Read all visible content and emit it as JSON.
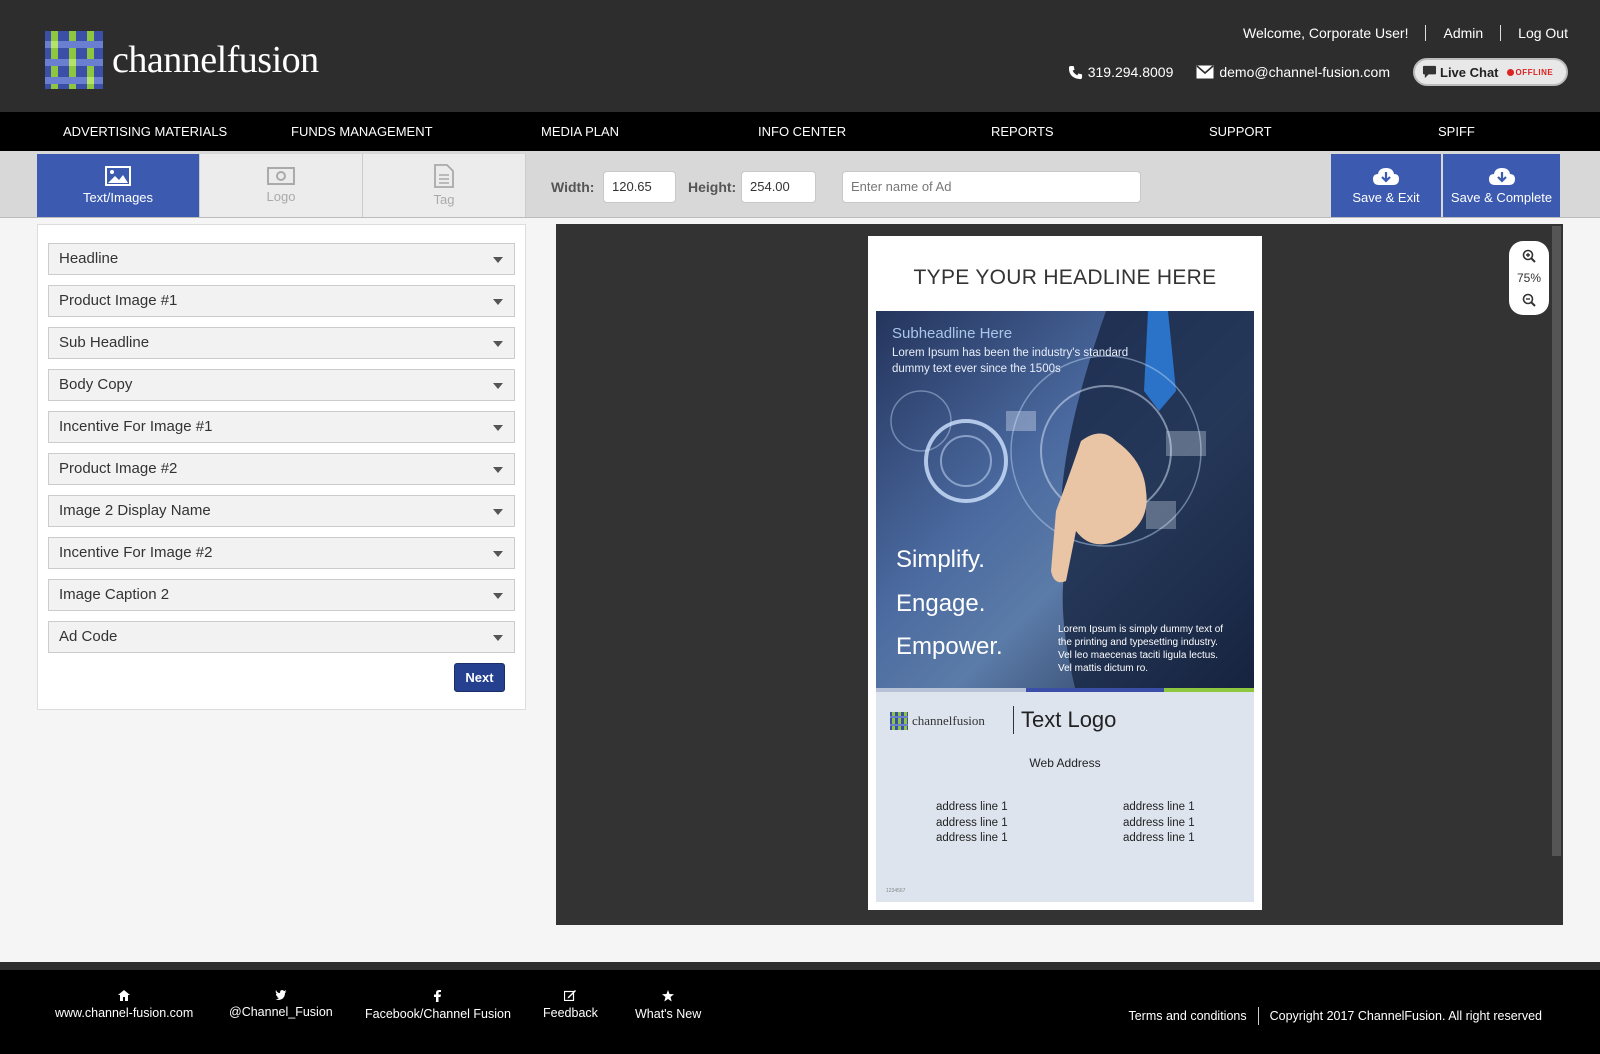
{
  "header": {
    "logo_text": "channelfusion",
    "welcome": "Welcome, Corporate User!",
    "admin": "Admin",
    "logout": "Log Out",
    "phone": "319.294.8009",
    "email": "demo@channel-fusion.com",
    "live_chat": "Live Chat",
    "live_chat_status": "OFFLINE"
  },
  "nav": {
    "items": [
      "ADVERTISING MATERIALS",
      "FUNDS MANAGEMENT",
      "MEDIA PLAN",
      "INFO CENTER",
      "REPORTS",
      "SUPPORT",
      "SPIFF"
    ]
  },
  "toolbar": {
    "tabs": [
      "Text/Images",
      "Logo",
      "Tag"
    ],
    "active_tab": "Text/Images",
    "width_label": "Width:",
    "width_value": "120.65",
    "height_label": "Height:",
    "height_value": "254.00",
    "ad_name_placeholder": "Enter name of Ad",
    "save_exit": "Save & Exit",
    "save_complete": "Save & Complete"
  },
  "fields": {
    "items": [
      "Headline",
      "Product Image #1",
      "Sub Headline",
      "Body Copy",
      "Incentive For Image #1",
      "Product Image #2",
      "Image 2 Display Name",
      "Incentive For Image #2",
      "Image Caption 2",
      "Ad Code"
    ],
    "next_label": "Next"
  },
  "preview": {
    "zoom_level": "75%",
    "ad": {
      "headline": "TYPE YOUR HEADLINE HERE",
      "subheadline": "Subheadline Here",
      "sub_body": "Lorem Ipsum has been the industry's standard dummy text ever since the 1500s",
      "tagline": [
        "Simplify.",
        "Engage.",
        "Empower."
      ],
      "body": "Lorem Ipsum is simply dummy text of the printing and typesetting industry. Vel leo maecenas taciti ligula lectus. Vel mattis dictum ro.",
      "brand": "channelfusion",
      "text_logo": "Text Logo",
      "web_address": "Web Address",
      "address_left": [
        "address line 1",
        "address line 1",
        "address line 1"
      ],
      "address_right": [
        "address line 1",
        "address line 1",
        "address line 1"
      ],
      "ad_code": "1234567"
    }
  },
  "footer": {
    "links": [
      "www.channel-fusion.com",
      "@Channel_Fusion",
      "Facebook/Channel Fusion",
      "Feedback",
      "What's New"
    ],
    "terms": "Terms and conditions",
    "copyright": "Copyright 2017 ChannelFusion. All right reserved"
  },
  "colors": {
    "header_bg": "#2d2d2d",
    "nav_bg": "#000000",
    "accent": "#3b5ab0",
    "next_button": "#24408e",
    "brand_green": "#8dc63f",
    "brand_blue": "#3b4fa8"
  }
}
